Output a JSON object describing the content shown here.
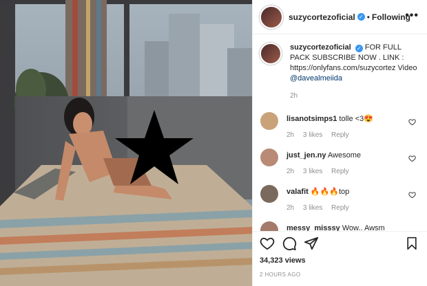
{
  "header": {
    "username": "suzycortezoficial",
    "follow_separator": "•",
    "follow_label": "Following",
    "more_label": "•••"
  },
  "caption": {
    "username": "suzycortezoficial",
    "text": "FOR FULL PACK SUBSCRIBE NOW . LINK :",
    "link": "https://onlyfans.com/suzycortez",
    "text2": "Video",
    "mention": "@davealmeiida",
    "time": "2h"
  },
  "comments": [
    {
      "username": "lisanotsimps1",
      "text": "tolle <3😍",
      "time": "2h",
      "likes": "3 likes",
      "reply": "Reply",
      "avatar_color": "#c9a27a"
    },
    {
      "username": "just_jen.ny",
      "text": "Awesome",
      "time": "2h",
      "likes": "3 likes",
      "reply": "Reply",
      "avatar_color": "#b98b76"
    },
    {
      "username": "valafit",
      "text": "🔥🔥🔥top",
      "time": "2h",
      "likes": "3 likes",
      "reply": "Reply",
      "avatar_color": "#7a6a5e"
    },
    {
      "username": "messy_misssy",
      "text": "Wow.. Awsm",
      "time": "",
      "likes": "",
      "reply": "",
      "avatar_color": "#a47a6a"
    }
  ],
  "stats": {
    "views": "34,323 views",
    "posted": "2 HOURS AGO"
  },
  "icons": [
    "heart-icon",
    "comment-icon",
    "share-icon",
    "bookmark-icon",
    "verified-badge-icon",
    "like-comment-icon"
  ],
  "colors": {
    "verified": "#3897f0",
    "link": "#00376b",
    "muted": "#8e8e8e",
    "text": "#262626"
  }
}
